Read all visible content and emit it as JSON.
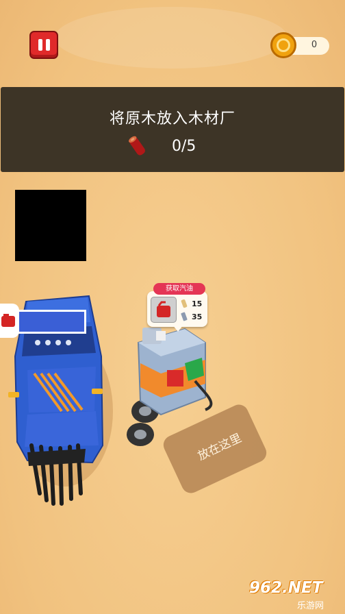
{
  "hud": {
    "coins": "0",
    "pause_icon": "pause-icon",
    "coin_icon": "gold-coin-icon"
  },
  "quest": {
    "title": "将原木放入木材厂",
    "progress": "0/5",
    "item_icon": "log-icon"
  },
  "fuel_station": {
    "header": "获取汽油",
    "item_icon": "fuel-can-icon",
    "costs": [
      {
        "icon": "wood-plank-icon",
        "amount": "15"
      },
      {
        "icon": "metal-ingot-icon",
        "amount": "35"
      }
    ]
  },
  "drop_zone": {
    "label": "放在这里"
  },
  "watermark": {
    "main": "962.NET",
    "sub": "乐游网"
  },
  "colors": {
    "sand": "#f4c98a",
    "panel": "#3d3426",
    "pause_red": "#e02a2a",
    "car_blue": "#2f5fd0",
    "pump_accent": "#e43555"
  }
}
